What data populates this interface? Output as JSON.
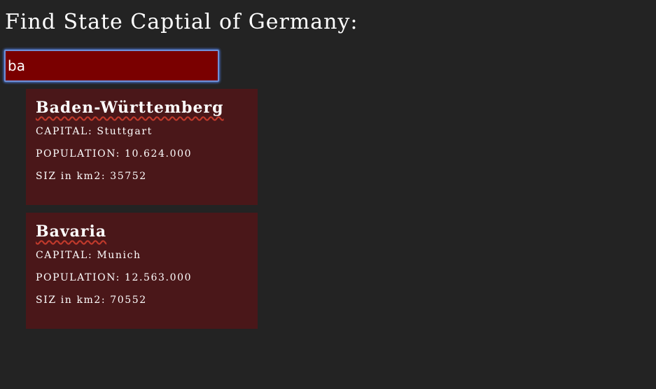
{
  "header": {
    "title": "Find State Captial of Germany:"
  },
  "search": {
    "value": "ba",
    "placeholder": ""
  },
  "results": [
    {
      "name": "Baden-Württemberg",
      "capital": "CAPITAL: Stuttgart",
      "population": "POPULATION: 10.624.000",
      "size": "SIZ in km2: 35752"
    },
    {
      "name": "Bavaria",
      "capital": "CAPITAL: Munich",
      "population": "POPULATION: 12.563.000",
      "size": "SIZ in km2: 70552"
    }
  ],
  "colors": {
    "background": "#232323",
    "input_background": "#7a0000",
    "input_focus_ring": "#6f8fd6",
    "card_background": "#4a1719",
    "misspelling_underline": "#c0392b"
  }
}
